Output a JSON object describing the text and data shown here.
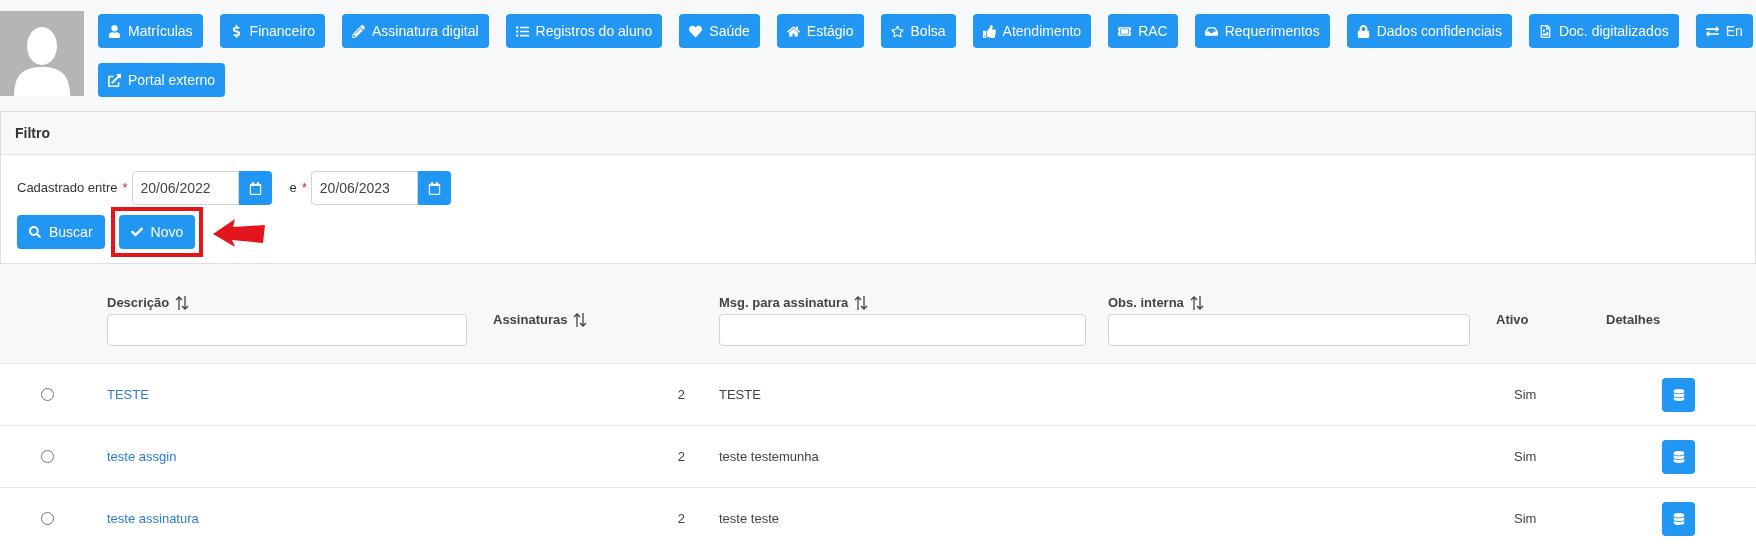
{
  "nav_buttons": [
    {
      "label": "Matrículas"
    },
    {
      "label": "Financeiro"
    },
    {
      "label": "Assinatura digital"
    },
    {
      "label": "Registros do aluno"
    },
    {
      "label": "Saúde"
    },
    {
      "label": "Estágio"
    },
    {
      "label": "Bolsa"
    },
    {
      "label": "Atendimento"
    },
    {
      "label": "RAC"
    },
    {
      "label": "Requerimentos"
    },
    {
      "label": "Dados confidenciais"
    },
    {
      "label": "Doc. digitalizados"
    },
    {
      "label": "En"
    },
    {
      "label": "Portal externo"
    }
  ],
  "filter": {
    "title": "Filtro",
    "fields": [
      {
        "label": "Cadastrado entre",
        "required_mark": "*",
        "value": "20/06/2022"
      },
      {
        "label": "e",
        "required_mark": "*",
        "value": "20/06/2023"
      }
    ],
    "buttons": [
      {
        "label": "Buscar",
        "kind": "search",
        "highlighted": false
      },
      {
        "label": "Novo",
        "kind": "new",
        "highlighted": true
      }
    ]
  },
  "table": {
    "columns": [
      {
        "label": "Descrição",
        "sortable": true,
        "filter": true
      },
      {
        "label": "Assinaturas",
        "sortable": true,
        "filter": false
      },
      {
        "label": "Msg. para assinatura",
        "sortable": true,
        "filter": true
      },
      {
        "label": "Obs. interna",
        "sortable": true,
        "filter": true
      },
      {
        "label": "Ativo",
        "sortable": false,
        "filter": false
      },
      {
        "label": "Detalhes",
        "sortable": false,
        "filter": false
      }
    ],
    "rows": [
      {
        "selected": false,
        "description": "TESTE",
        "signatures": "2",
        "message": "TESTE",
        "active": "Sim"
      },
      {
        "selected": false,
        "description": "teste assgin",
        "signatures": "2",
        "message": "teste testemunha",
        "active": "Sim"
      },
      {
        "selected": false,
        "description": "teste assinatura",
        "signatures": "2",
        "message": "teste teste",
        "active": "Sim"
      }
    ]
  }
}
